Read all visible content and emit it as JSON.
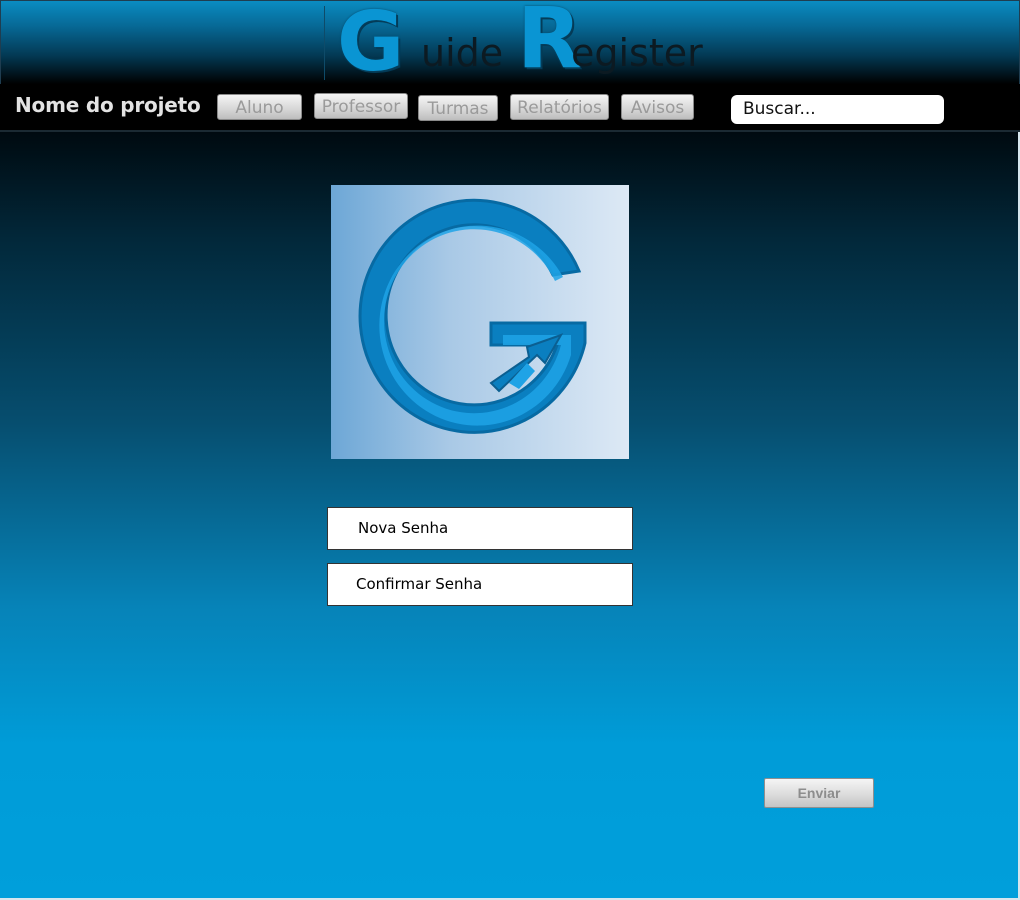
{
  "header": {
    "logo": {
      "word1_initial": "G",
      "word1_rest": "uide",
      "word2_initial": "R",
      "word2_rest": "egister"
    }
  },
  "navbar": {
    "project_name": "Nome do projeto",
    "items": [
      {
        "label": "Aluno"
      },
      {
        "label": "Professor"
      },
      {
        "label": "Turmas"
      },
      {
        "label": "Relatórios"
      },
      {
        "label": "Avisos"
      }
    ],
    "search": {
      "placeholder": "Buscar..."
    }
  },
  "main": {
    "logo_card_letter": "G",
    "fields": {
      "new_password": "Nova Senha",
      "confirm_password": "Confirmar Senha"
    },
    "send_label": "Enviar"
  },
  "colors": {
    "accent": "#0a95d3",
    "header_top": "#0a8cc2",
    "body_bottom": "#009fdb"
  }
}
